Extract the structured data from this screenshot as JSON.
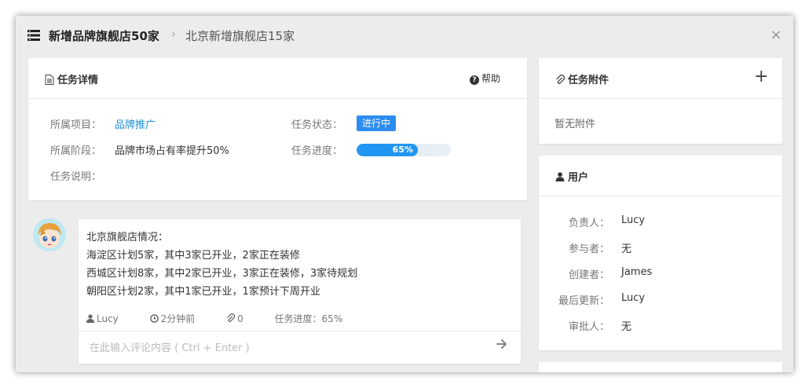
{
  "header": {
    "title": "新增品牌旗舰店50家",
    "separator": "›",
    "subtitle": "北京新增旗舰店15家",
    "close_label": "×"
  },
  "detail": {
    "title": "任务详情",
    "help_label": "帮助",
    "project_label": "所属项目：",
    "project_value": "品牌推广",
    "stage_label": "所属阶段：",
    "stage_value": "品牌市场占有率提升50%",
    "desc_label": "任务说明：",
    "status_label": "任务状态：",
    "status_value": "进行中",
    "progress_label": "任务进度：",
    "progress_value": 65,
    "progress_text": "65%"
  },
  "comment": {
    "lines": [
      "北京旗舰店情况：",
      "海淀区计划5家，其中3家已开业，2家正在装修",
      "西城区计划8家，其中2家已开业，3家正在装修，3家待规划",
      "朝阳区计划2家，其中1家已开业，1家预计下周开业"
    ],
    "author": "Lucy",
    "time": "2分钟前",
    "attachments": "0",
    "progress": "任务进度：65%",
    "input_placeholder": "在此输入评论内容 ( Ctrl + Enter )"
  },
  "attachments": {
    "title": "任务附件",
    "add_label": "+",
    "empty_text": "暂无附件"
  },
  "users": {
    "title": "用户",
    "rows": [
      {
        "label": "负责人：",
        "value": "Lucy"
      },
      {
        "label": "参与者：",
        "value": "无"
      },
      {
        "label": "创建者：",
        "value": "James"
      },
      {
        "label": "最后更新：",
        "value": "Lucy"
      },
      {
        "label": "审批人：",
        "value": "无"
      }
    ]
  },
  "colors": {
    "accent": "#2196f3",
    "badge": "#2d8cf0",
    "link": "#1a8fd8",
    "backdrop": "#ececec"
  }
}
